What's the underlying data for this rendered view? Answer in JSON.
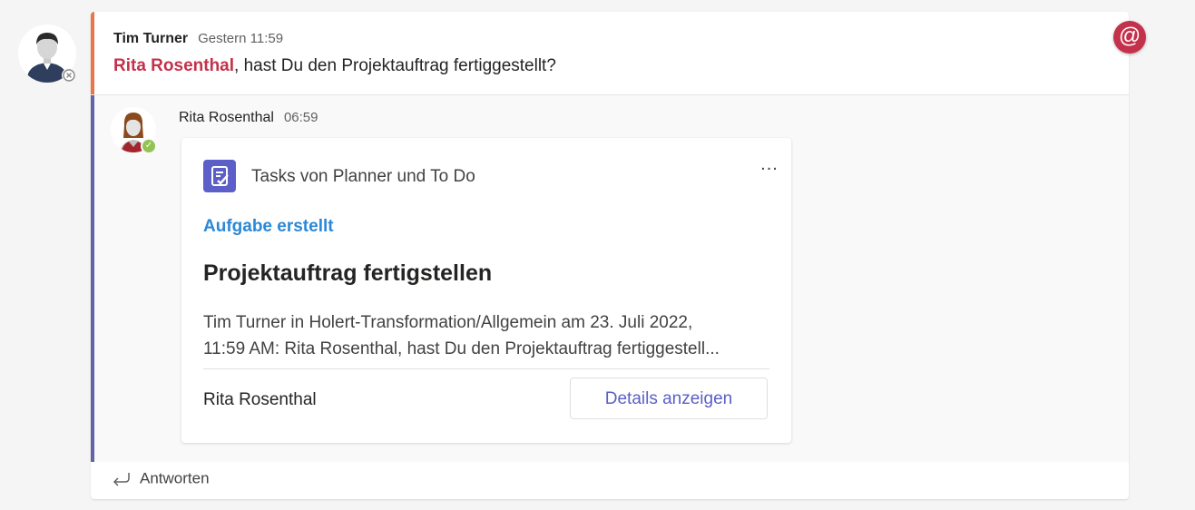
{
  "message": {
    "author": "Tim Turner",
    "timestamp": "Gestern 11:59",
    "mention": "Rita Rosenthal",
    "text": ", hast Du den Projektauftrag fertiggestellt?",
    "mention_badge": "@"
  },
  "reply": {
    "author": "Rita Rosenthal",
    "timestamp": "06:59",
    "card": {
      "app_name": "Tasks von Planner und To Do",
      "more_label": "...",
      "status": "Aufgabe erstellt",
      "title": "Projektauftrag fertigstellen",
      "description_line1": "Tim Turner in Holert-Transformation/Allgemein am 23. Juli 2022,",
      "description_line2": "11:59 AM: Rita Rosenthal, hast Du den Projektauftrag fertiggestell...",
      "assignee": "Rita Rosenthal",
      "details_button": "Details anzeigen"
    }
  },
  "reply_button": "Antworten",
  "colors": {
    "mention_accent": "#e97548",
    "thread_accent": "#6264a7",
    "mention_text": "#c4314b",
    "link_blue": "#2b88d8",
    "brand": "#5b5fc7",
    "presence_available": "#92c353"
  }
}
